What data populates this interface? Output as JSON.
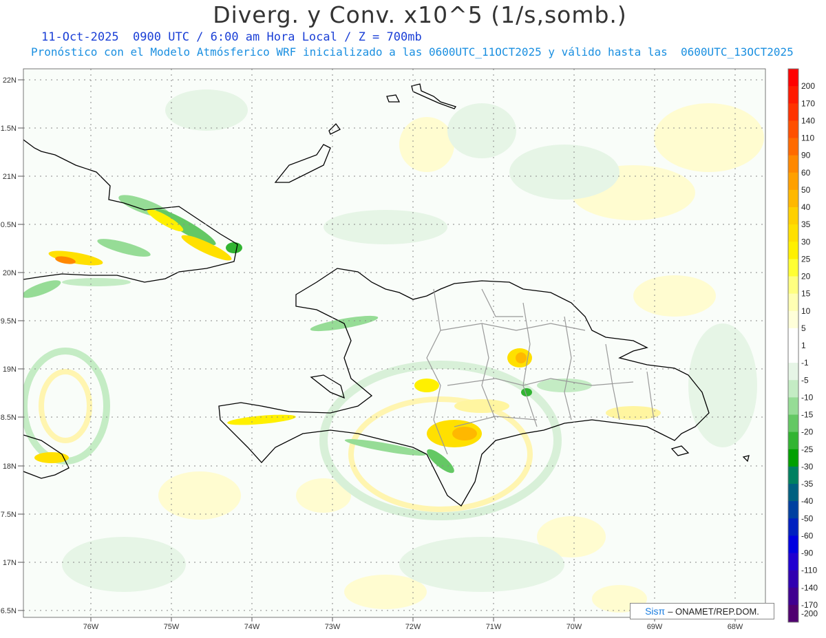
{
  "title": "Diverg. y Conv. x10^5 (1/s,somb.)",
  "subtitle_line1": "11-Oct-2025  0900 UTC / 6:00 am Hora Local / Z = 700mb",
  "subtitle_line2": "Pronóstico con el Modelo Atmósferico WRF inicializado a las 0600UTC_11OCT2025 y válido hasta las  0600UTC_13OCT2025",
  "lat_labels": [
    "22N",
    "1.5N",
    "21N",
    "0.5N",
    "20N",
    "9.5N",
    "19N",
    "8.5N",
    "18N",
    "7.5N",
    "17N",
    "6.5N"
  ],
  "lon_labels": [
    "76W",
    "75W",
    "74W",
    "73W",
    "72W",
    "71W",
    "70W",
    "69W",
    "68W"
  ],
  "colorbar": {
    "labels": [
      "200",
      "170",
      "140",
      "110",
      "90",
      "60",
      "50",
      "40",
      "35",
      "30",
      "25",
      "20",
      "15",
      "10",
      "5",
      "1",
      "-1",
      "-5",
      "-10",
      "-15",
      "-20",
      "-25",
      "-30",
      "-35",
      "-40",
      "-50",
      "-60",
      "-90",
      "-110",
      "-140",
      "-170",
      "-200"
    ],
    "colors": [
      "#ff0000",
      "#ff1a00",
      "#ff3300",
      "#ff5000",
      "#ff6a00",
      "#ff8800",
      "#ffa000",
      "#ffb800",
      "#ffd000",
      "#ffe000",
      "#fff000",
      "#ffff33",
      "#ffff80",
      "#ffffb3",
      "#ffffd9",
      "#ffffff",
      "#ffffff",
      "#e6f5e6",
      "#c4ecc4",
      "#96dc96",
      "#64c864",
      "#32b432",
      "#00a000",
      "#008060",
      "#006080",
      "#0040a0",
      "#0020c0",
      "#0000e0",
      "#2000d0",
      "#3000b0",
      "#400090",
      "#500070"
    ]
  },
  "credit": {
    "brand": "Sisπ",
    "text": "– ONAMET/REP.DOM."
  }
}
